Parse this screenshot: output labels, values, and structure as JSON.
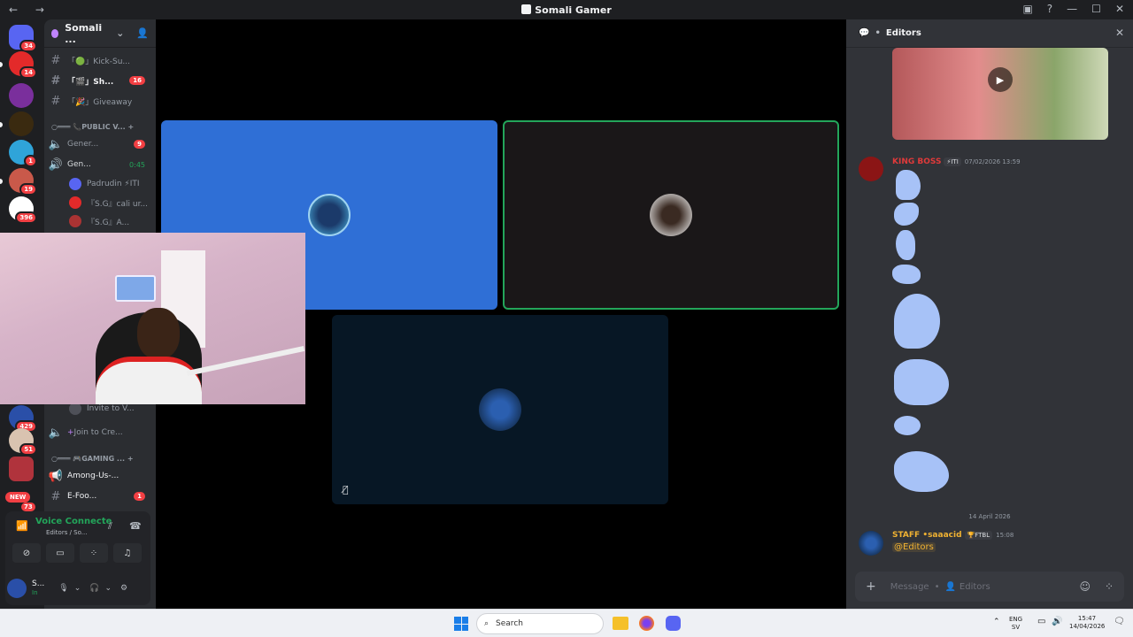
{
  "window": {
    "title": "Somali Gamer"
  },
  "rail": {
    "servers": [
      {
        "badge": "34",
        "color": "#5865f2"
      },
      {
        "badge": "14",
        "color": "#e32a2a"
      },
      {
        "badge": "",
        "color": "#7a2f9c"
      },
      {
        "badge": "",
        "color": "#3a2a10"
      },
      {
        "badge": "1",
        "color": "#2fa4d9"
      },
      {
        "badge": "19",
        "color": "#c9594a"
      },
      {
        "badge": "396",
        "color": "#ffffff"
      },
      {
        "badge": "429",
        "color": "#2a4fa8"
      },
      {
        "badge": "51",
        "color": "#d9c3b0"
      },
      {
        "badge": "",
        "color": "#b0333c"
      },
      {
        "badge": "73",
        "color": "#c02a2a"
      }
    ],
    "new_label": "NEW"
  },
  "channels": {
    "server_name": "Somali ...",
    "items": [
      {
        "label": "「🟢」Kick-Su..."
      },
      {
        "label": "「🎬」Sh...",
        "badge": "16"
      },
      {
        "label": "「🎉」Giveaway"
      }
    ],
    "category_public": "PUBLIC V...",
    "voice_channels": [
      {
        "label": "Gener...",
        "badge": "9"
      },
      {
        "label": "Gen...",
        "time": "0:45"
      }
    ],
    "voice_users": [
      {
        "name": "Padrudin ⚡ITI"
      },
      {
        "name": "『S.G』cali ur..."
      },
      {
        "name": "『S.G』A..."
      }
    ],
    "invite": "Invite to V...",
    "join": "Join to Cre...",
    "category_gaming": "GAMING ...",
    "gaming_items": [
      {
        "label": "Among-Us-..."
      },
      {
        "label": "E-Foo...",
        "badge": "1"
      }
    ]
  },
  "voice": {
    "status": "Voice Connecte",
    "subtitle": "Editors / So...",
    "user_short": "S...",
    "user_status": "In"
  },
  "stage": {
    "tiles": [
      {
        "name": "Somali Gamer tile",
        "bg": "#2f6fd6",
        "active": false
      },
      {
        "name": "speaker tile",
        "bg": "#1a1718",
        "active": true
      },
      {
        "name": "member tile",
        "bg": "#071725",
        "active": false
      }
    ]
  },
  "chat": {
    "channel": "Editors",
    "msg1": {
      "author": "KING BOSS",
      "tag": "⚡ITI",
      "time": "07/02/2026 13:59"
    },
    "date_divider": "14 April 2026",
    "msg2": {
      "author": "STAFF •saaacid",
      "tag": "🏆FTBL",
      "time": "15:08",
      "mention": "@Editors"
    },
    "composer_placeholder": "Message",
    "composer_channel": "Editors"
  },
  "taskbar": {
    "search": "Search",
    "lang1": "ENG",
    "lang2": "SV",
    "time": "15:47",
    "date": "14/04/2026"
  },
  "colors": {
    "accent": "#5865f2",
    "online": "#23a55a",
    "badge": "#f23f43",
    "speaking": "#23a55a"
  }
}
